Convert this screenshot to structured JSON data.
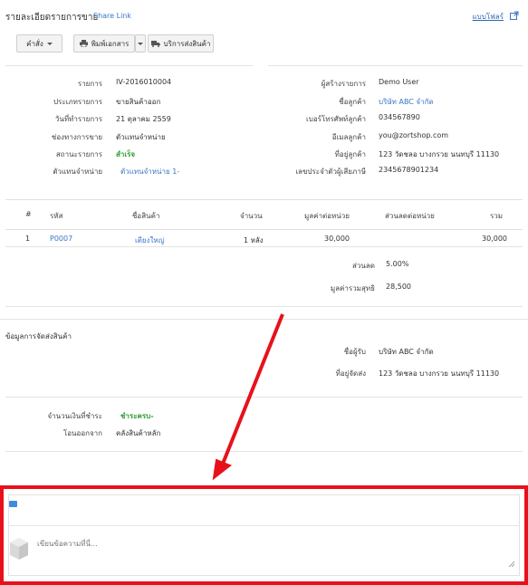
{
  "header": {
    "title": "รายละเอียดรายการขาย",
    "share_label": "Share Link",
    "profile_label": "แบบโฟลร์"
  },
  "toolbar": {
    "command_label": "คำสั่ง",
    "print_label": "พิมพ์เอกสาร",
    "shipping_label": "บริการส่งสินค้า"
  },
  "order": {
    "left": [
      {
        "label": "รายการ",
        "value": "IV-2016010004",
        "style": ""
      },
      {
        "label": "ประเภทรายการ",
        "value": "ขายสินค้าออก",
        "style": ""
      },
      {
        "label": "วันที่ทำรายการ",
        "value": "21 ตุลาคม 2559",
        "style": ""
      },
      {
        "label": "ช่องทางการขาย",
        "value": "ตัวแทนจำหน่าย",
        "style": ""
      },
      {
        "label": "สถานะรายการ",
        "value": "สำเร็จ",
        "style": "green"
      },
      {
        "label": "ตัวแทนจำหน่าย",
        "value": "ตัวแทนจำหน่าย 1-",
        "style": "link"
      }
    ],
    "right": [
      {
        "label": "ผู้สร้างรายการ",
        "value": "Demo User",
        "style": ""
      },
      {
        "label": "ชื่อลูกค้า",
        "value": "บริษัท ABC จำกัด",
        "style": "link"
      },
      {
        "label": "เบอร์โทรศัพท์ลูกค้า",
        "value": "034567890",
        "style": ""
      },
      {
        "label": "อีเมลลูกค้า",
        "value": "you@zortshop.com",
        "style": ""
      },
      {
        "label": "ที่อยู่ลูกค้า",
        "value": "123 วัดชลอ บางกรวย นนทบุรี 11130",
        "style": ""
      },
      {
        "label": "เลขประจำตัวผู้เสียภาษี",
        "value": "2345678901234",
        "style": ""
      }
    ]
  },
  "table": {
    "headers": [
      "#",
      "รหัส",
      "ชื่อสินค้า",
      "จำนวน",
      "มูลค่าต่อหน่วย",
      "ส่วนลดต่อหน่วย",
      "รวม"
    ],
    "rows": [
      {
        "no": "1",
        "code": "P0007",
        "name": "เตียงใหญ่",
        "qty": "1 หลัง",
        "unit_price": "30,000",
        "unit_discount": "",
        "total": "30,000"
      }
    ]
  },
  "summary": {
    "discount_label": "ส่วนลด",
    "discount_value": "5.00%",
    "net_label": "มูลค่ารวมสุทธิ",
    "net_value": "28,500"
  },
  "shipping": {
    "section_title": "ข้อมูลการจัดส่งสินค้า",
    "receiver_label": "ชื่อผู้รับ",
    "receiver_value": "บริษัท ABC จำกัด",
    "address_label": "ที่อยู่จัดส่ง",
    "address_value": "123 วัดชลอ บางกรวย นนทบุรี 11130"
  },
  "payment": {
    "amount_label": "จำนวนเงินที่ชำระ",
    "amount_value": "ชำระครบ-",
    "transfer_label": "โอนออกจาก",
    "transfer_value": "คลังสินค้าหลัก"
  },
  "comment": {
    "placeholder": "เขียนข้อความที่นี่..."
  },
  "colors": {
    "accent": "#3a76c4",
    "success": "#2f9a2f",
    "highlight": "#e8111b"
  }
}
